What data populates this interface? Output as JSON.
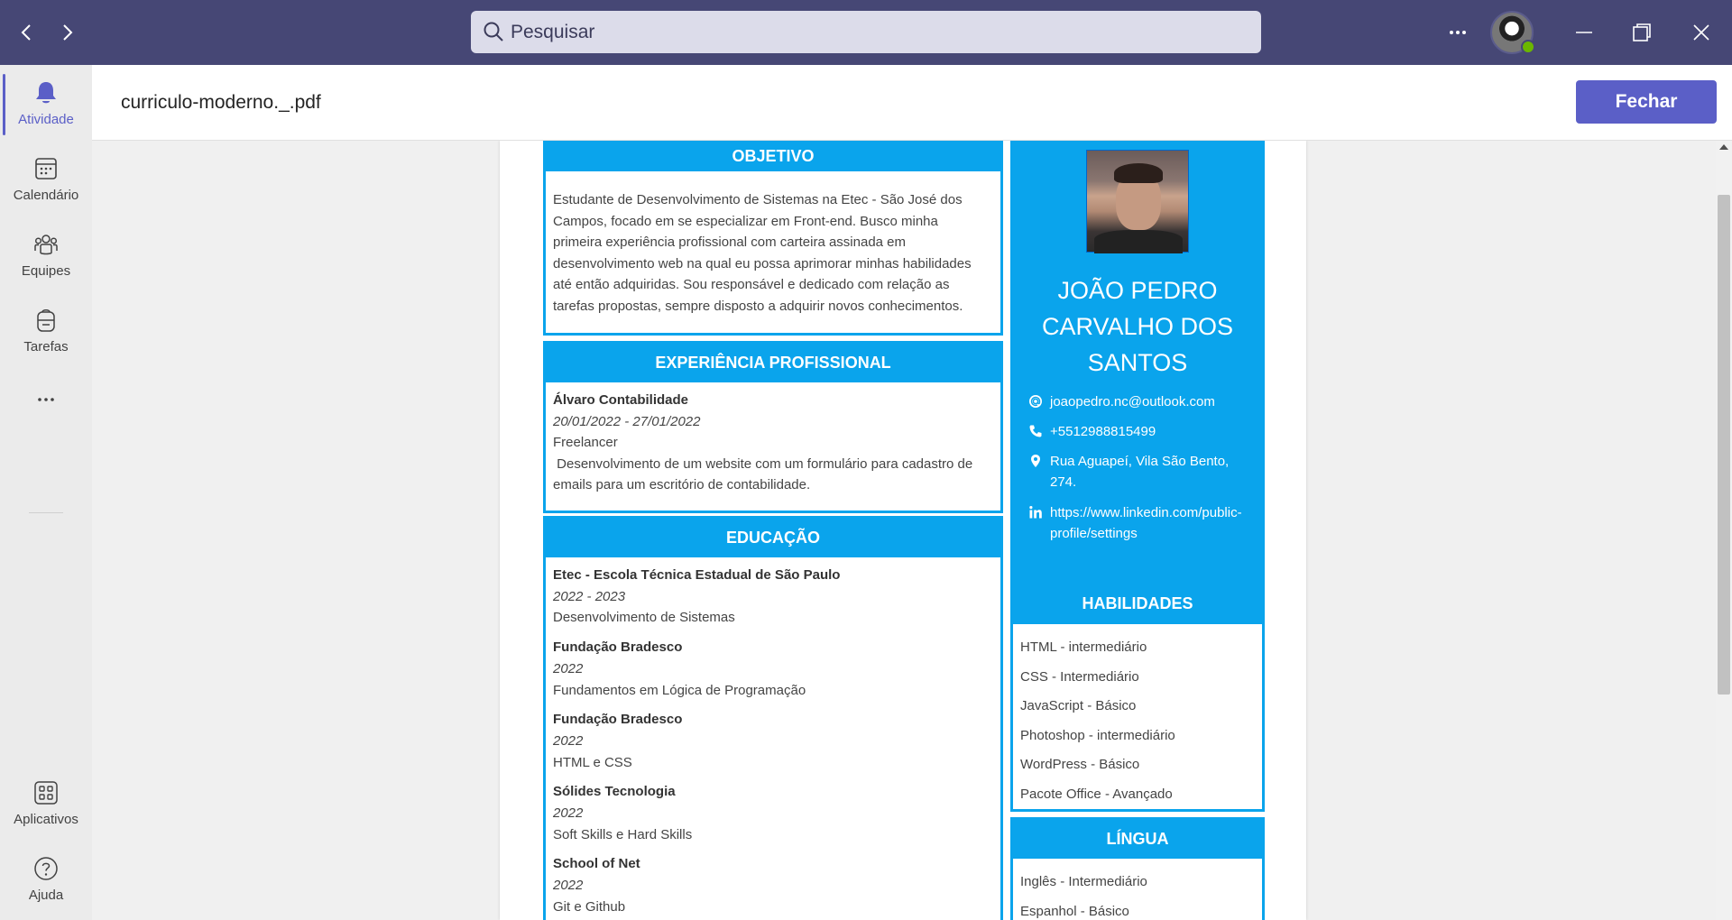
{
  "search": {
    "placeholder": "Pesquisar"
  },
  "rail": {
    "items": [
      {
        "label": "Atividade",
        "icon": "bell-icon"
      },
      {
        "label": "Calendário",
        "icon": "calendar-icon"
      },
      {
        "label": "Equipes",
        "icon": "teams-icon"
      },
      {
        "label": "Tarefas",
        "icon": "backpack-icon"
      },
      {
        "label": "Aplicativos",
        "icon": "apps-icon"
      },
      {
        "label": "Ajuda",
        "icon": "help-icon"
      }
    ]
  },
  "header": {
    "filename": "curriculo-moderno._.pdf",
    "close_label": "Fechar"
  },
  "colors": {
    "accent": "#5b5fc7",
    "titlebar": "#464775",
    "resume_blue": "#0aa4ec"
  },
  "resume": {
    "objective": {
      "title": "OBJETIVO",
      "lines": [
        "Estudante de Desenvolvimento de Sistemas na Etec - São José dos",
        "Campos, focado em se especializar em Front-end. Busco minha",
        "primeira experiência profissional com carteira assinada em",
        "desenvolvimento web na qual eu possa aprimorar minhas habilidades",
        "até então adquiridas. Sou responsável e dedicado com relação as",
        "tarefas propostas, sempre disposto a adquirir novos conhecimentos."
      ]
    },
    "experience": {
      "title": "EXPERIÊNCIA PROFISSIONAL",
      "company": "Álvaro Contabilidade",
      "period": "20/01/2022 - 27/01/2022",
      "role": "Freelancer",
      "desc_line1": " Desenvolvimento de um website com um formulário para cadastro de",
      "desc_line2": "emails para um escritório de contabilidade."
    },
    "education": {
      "title": "EDUCAÇÃO",
      "items": [
        {
          "school": "Etec - Escola Técnica Estadual de São Paulo",
          "period": "2022 - 2023",
          "course": "Desenvolvimento de Sistemas"
        },
        {
          "school": "Fundação Bradesco",
          "period": "2022",
          "course": "Fundamentos em Lógica de Programação"
        },
        {
          "school": "Fundação Bradesco",
          "period": "2022",
          "course": "HTML e CSS"
        },
        {
          "school": "Sólides Tecnologia",
          "period": "2022",
          "course": "Soft Skills e Hard Skills"
        },
        {
          "school": "School of Net",
          "period": "2022",
          "course": "Git e Github"
        }
      ]
    },
    "profile": {
      "name_line1": "JOÃO PEDRO",
      "name_line2": "CARVALHO DOS",
      "name_line3": "SANTOS",
      "email": "joaopedro.nc@outlook.com",
      "phone": "+5512988815499",
      "address_line1": "Rua Aguapeí, Vila São Bento,",
      "address_line2": "274.",
      "linkedin_line1": "https://www.linkedin.com/public-",
      "linkedin_line2": "profile/settings"
    },
    "skills": {
      "title": "HABILIDADES",
      "items": [
        "HTML - intermediário",
        "CSS - Intermediário",
        "JavaScript - Básico",
        "Photoshop - intermediário",
        "WordPress - Básico",
        "Pacote Office - Avançado"
      ]
    },
    "languages": {
      "title": "LÍNGUA",
      "items": [
        "Inglês - Intermediário",
        "Espanhol - Básico"
      ]
    }
  }
}
